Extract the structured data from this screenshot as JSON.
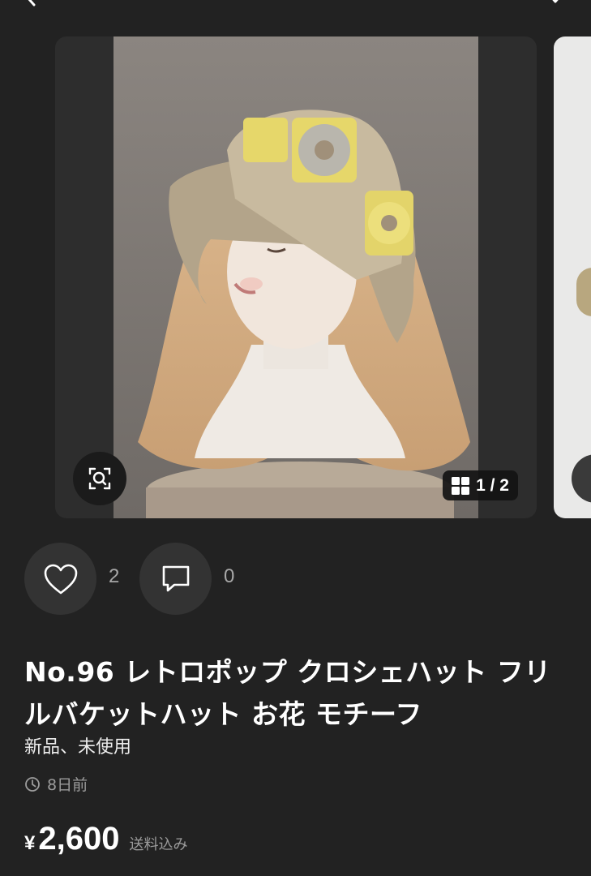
{
  "carousel": {
    "counter_text": "1 / 2",
    "current_index": 1,
    "total": 2
  },
  "actions": {
    "like_count": "2",
    "comment_count": "0"
  },
  "product": {
    "title": "No.96 レトロポップ クロシェハット フリルバケットハット お花 モチーフ",
    "condition": "新品、未使用",
    "posted": "8日前",
    "currency_symbol": "¥",
    "price": "2,600",
    "shipping": "送料込み"
  },
  "colors": {
    "background": "#222222",
    "card": "#2d2d2d",
    "button": "#333333",
    "muted_text": "#9c9c9c"
  },
  "icons": [
    "back-chevron-icon",
    "menu-chevron-icon",
    "zoom-scan-icon",
    "grid-icon",
    "heart-icon",
    "comment-icon",
    "clock-icon"
  ]
}
